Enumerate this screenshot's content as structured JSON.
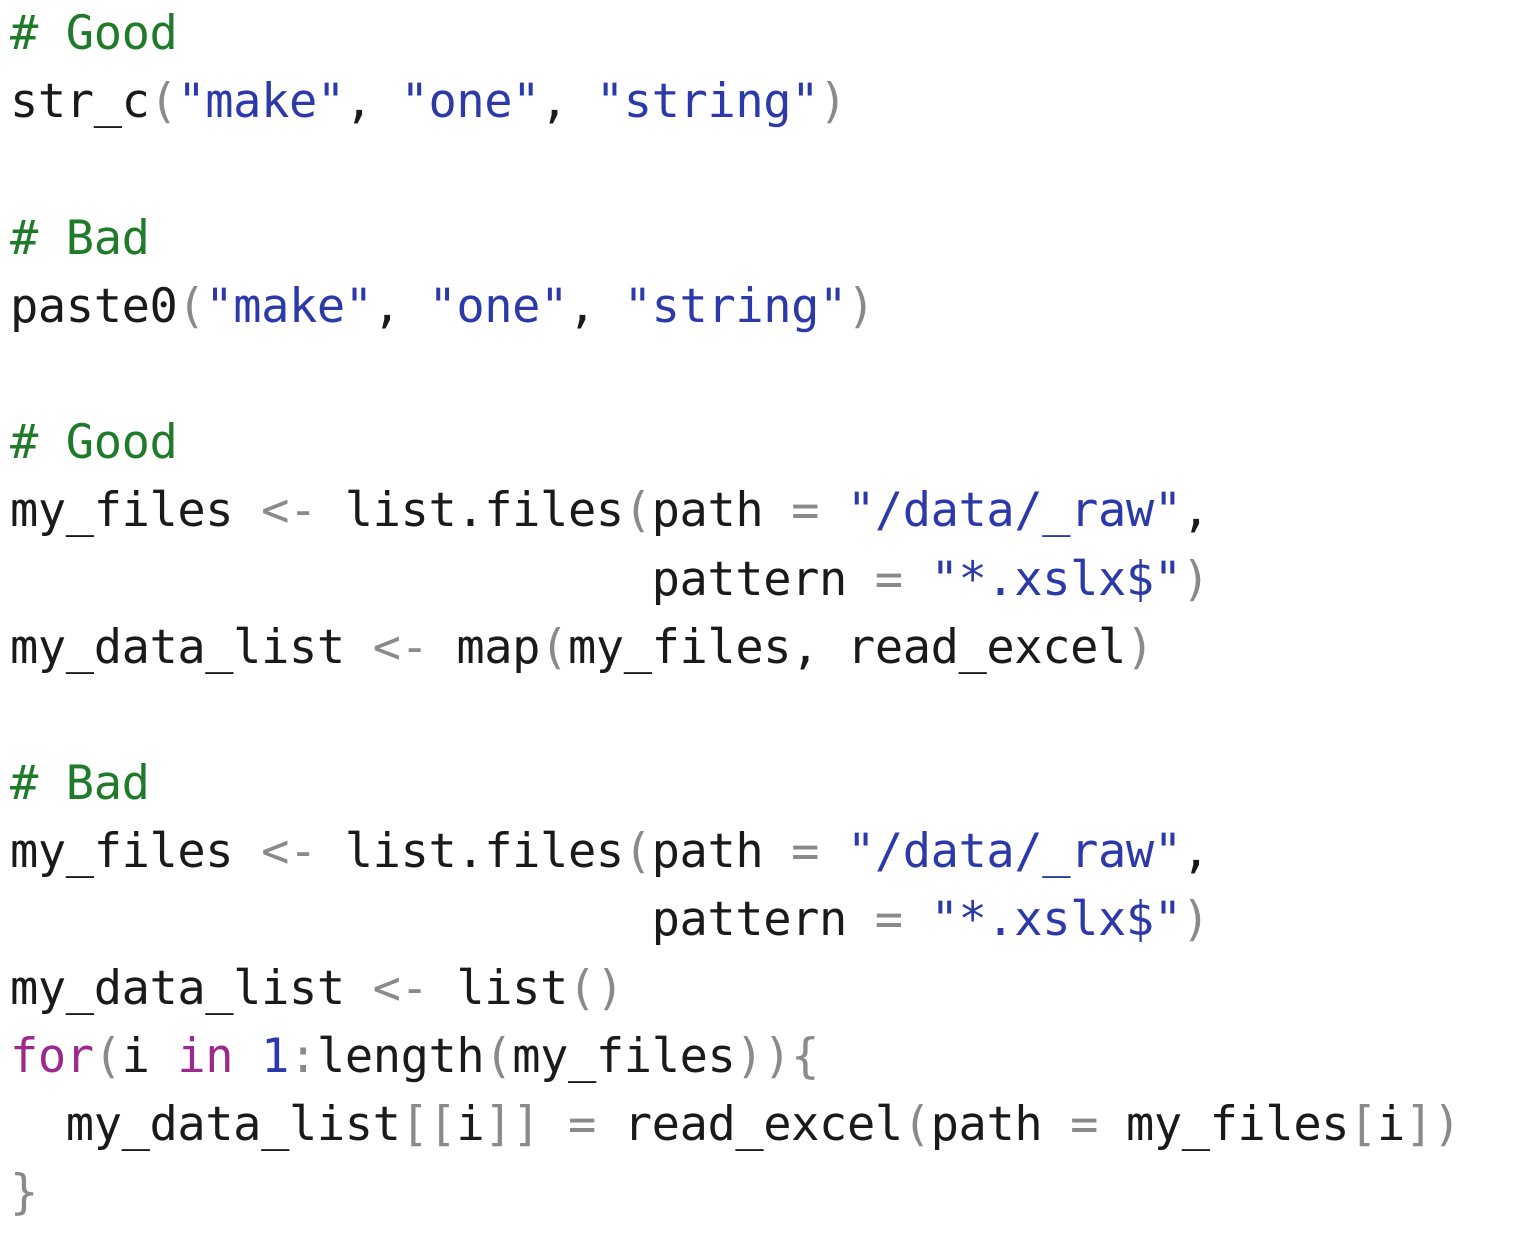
{
  "code": {
    "language": "R",
    "colors": {
      "comment": "#1f7a2a",
      "string": "#2b3aa8",
      "keyword": "#9a2a8e",
      "number": "#2b3aa8",
      "operator": "#8a8a8a",
      "text": "#1a1a1a"
    },
    "lines": [
      [
        {
          "t": "comment",
          "v": "# Good"
        }
      ],
      [
        {
          "t": "plain",
          "v": "str_c"
        },
        {
          "t": "op",
          "v": "("
        },
        {
          "t": "string",
          "v": "\"make\""
        },
        {
          "t": "plain",
          "v": ", "
        },
        {
          "t": "string",
          "v": "\"one\""
        },
        {
          "t": "plain",
          "v": ", "
        },
        {
          "t": "string",
          "v": "\"string\""
        },
        {
          "t": "op",
          "v": ")"
        }
      ],
      [],
      [
        {
          "t": "comment",
          "v": "# Bad"
        }
      ],
      [
        {
          "t": "plain",
          "v": "paste0"
        },
        {
          "t": "op",
          "v": "("
        },
        {
          "t": "string",
          "v": "\"make\""
        },
        {
          "t": "plain",
          "v": ", "
        },
        {
          "t": "string",
          "v": "\"one\""
        },
        {
          "t": "plain",
          "v": ", "
        },
        {
          "t": "string",
          "v": "\"string\""
        },
        {
          "t": "op",
          "v": ")"
        }
      ],
      [],
      [
        {
          "t": "comment",
          "v": "# Good"
        }
      ],
      [
        {
          "t": "plain",
          "v": "my_files "
        },
        {
          "t": "op",
          "v": "<-"
        },
        {
          "t": "plain",
          "v": " list.files"
        },
        {
          "t": "op",
          "v": "("
        },
        {
          "t": "plain",
          "v": "path "
        },
        {
          "t": "op",
          "v": "="
        },
        {
          "t": "plain",
          "v": " "
        },
        {
          "t": "string",
          "v": "\"/data/_raw\""
        },
        {
          "t": "plain",
          "v": ","
        }
      ],
      [
        {
          "t": "plain",
          "v": "                       pattern "
        },
        {
          "t": "op",
          "v": "="
        },
        {
          "t": "plain",
          "v": " "
        },
        {
          "t": "string",
          "v": "\"*.xslx$\""
        },
        {
          "t": "op",
          "v": ")"
        }
      ],
      [
        {
          "t": "plain",
          "v": "my_data_list "
        },
        {
          "t": "op",
          "v": "<-"
        },
        {
          "t": "plain",
          "v": " map"
        },
        {
          "t": "op",
          "v": "("
        },
        {
          "t": "plain",
          "v": "my_files, read_excel"
        },
        {
          "t": "op",
          "v": ")"
        }
      ],
      [],
      [
        {
          "t": "comment",
          "v": "# Bad"
        }
      ],
      [
        {
          "t": "plain",
          "v": "my_files "
        },
        {
          "t": "op",
          "v": "<-"
        },
        {
          "t": "plain",
          "v": " list.files"
        },
        {
          "t": "op",
          "v": "("
        },
        {
          "t": "plain",
          "v": "path "
        },
        {
          "t": "op",
          "v": "="
        },
        {
          "t": "plain",
          "v": " "
        },
        {
          "t": "string",
          "v": "\"/data/_raw\""
        },
        {
          "t": "plain",
          "v": ","
        }
      ],
      [
        {
          "t": "plain",
          "v": "                       pattern "
        },
        {
          "t": "op",
          "v": "="
        },
        {
          "t": "plain",
          "v": " "
        },
        {
          "t": "string",
          "v": "\"*.xslx$\""
        },
        {
          "t": "op",
          "v": ")"
        }
      ],
      [
        {
          "t": "plain",
          "v": "my_data_list "
        },
        {
          "t": "op",
          "v": "<-"
        },
        {
          "t": "plain",
          "v": " list"
        },
        {
          "t": "op",
          "v": "()"
        }
      ],
      [
        {
          "t": "keyword",
          "v": "for"
        },
        {
          "t": "op",
          "v": "("
        },
        {
          "t": "plain",
          "v": "i "
        },
        {
          "t": "keyword",
          "v": "in"
        },
        {
          "t": "plain",
          "v": " "
        },
        {
          "t": "number",
          "v": "1"
        },
        {
          "t": "op",
          "v": ":"
        },
        {
          "t": "plain",
          "v": "length"
        },
        {
          "t": "op",
          "v": "("
        },
        {
          "t": "plain",
          "v": "my_files"
        },
        {
          "t": "op",
          "v": ")){"
        }
      ],
      [
        {
          "t": "plain",
          "v": "  my_data_list"
        },
        {
          "t": "op",
          "v": "[["
        },
        {
          "t": "plain",
          "v": "i"
        },
        {
          "t": "op",
          "v": "]]"
        },
        {
          "t": "plain",
          "v": " "
        },
        {
          "t": "op",
          "v": "="
        },
        {
          "t": "plain",
          "v": " read_excel"
        },
        {
          "t": "op",
          "v": "("
        },
        {
          "t": "plain",
          "v": "path "
        },
        {
          "t": "op",
          "v": "="
        },
        {
          "t": "plain",
          "v": " my_files"
        },
        {
          "t": "op",
          "v": "["
        },
        {
          "t": "plain",
          "v": "i"
        },
        {
          "t": "op",
          "v": "])"
        }
      ],
      [
        {
          "t": "op",
          "v": "}"
        }
      ]
    ]
  }
}
